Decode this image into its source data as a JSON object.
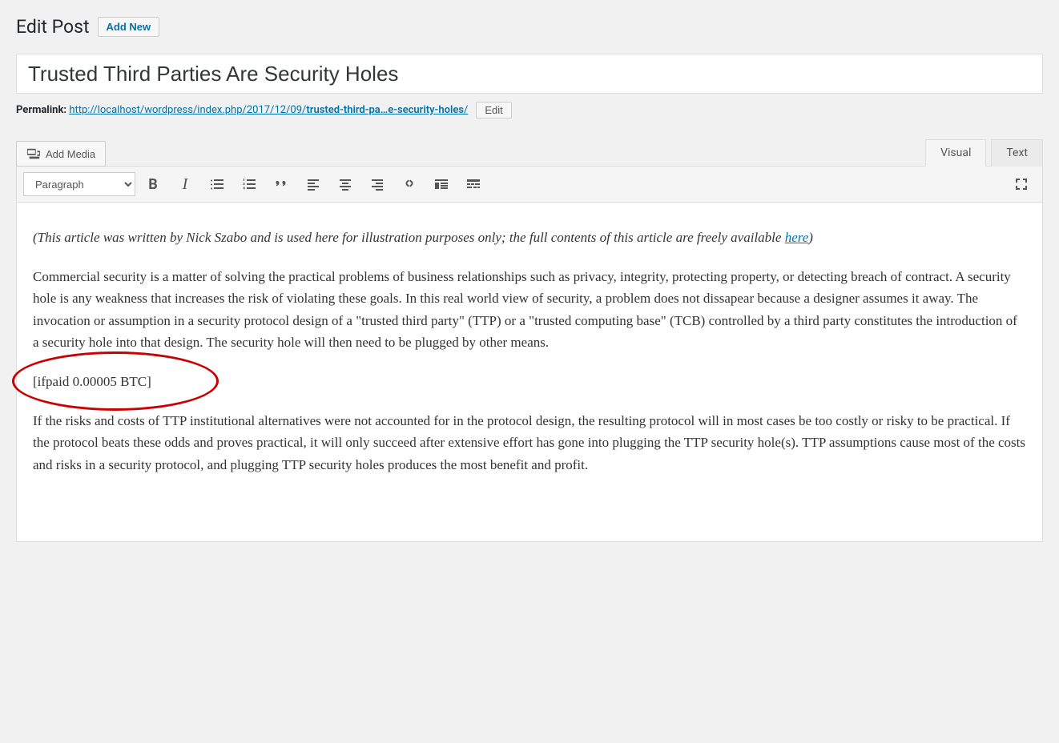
{
  "header": {
    "title": "Edit Post",
    "add_new": "Add New"
  },
  "post": {
    "title": "Trusted Third Parties Are Security Holes"
  },
  "permalink": {
    "label": "Permalink:",
    "base": "http://localhost/wordpress/index.php/2017/12/09/",
    "slug": "trusted-third-pa…e-security-holes",
    "trail": "/",
    "edit": "Edit"
  },
  "media": {
    "add": "Add Media"
  },
  "tabs": {
    "visual": "Visual",
    "text": "Text"
  },
  "toolbar": {
    "format": "Paragraph"
  },
  "content": {
    "intro_prefix": "(This article was written by Nick Szabo and is used here for illustration purposes only; the full contents of this article are freely available ",
    "intro_link": "here",
    "intro_suffix": ")",
    "p1": "Commercial security is a matter of solving the practical problems of business relationships such as privacy, integrity, protecting property, or detecting breach of contract. A security hole is any weakness that increases the risk of violating these goals. In this real world view of security, a problem does not dissapear because a designer assumes it away. The invocation or assumption in a security protocol design of a \"trusted third party\" (TTP) or a \"trusted computing base\" (TCB) controlled by a third party constitutes the introduction of a security hole into that design. The security hole will then need to be plugged by other means.",
    "shortcode": "[ifpaid 0.00005 BTC]",
    "p2": "If the risks and costs of TTP institutional alternatives were not accounted for in the protocol design, the resulting protocol will in most cases be too costly or risky to be practical. If the protocol beats these odds and proves practical, it will only succeed after extensive effort has gone into plugging the TTP security hole(s). TTP assumptions cause most of the costs and risks in a security protocol, and plugging TTP security holes produces the most benefit and profit."
  }
}
